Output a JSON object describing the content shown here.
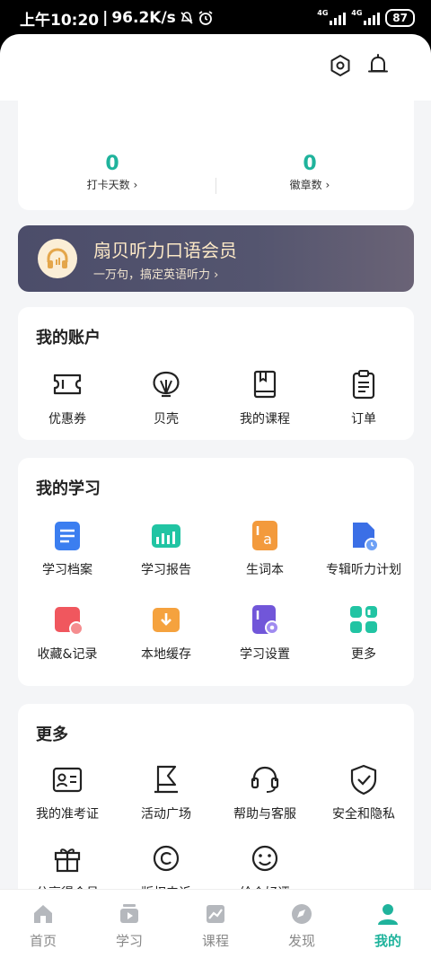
{
  "status_bar": {
    "time": "上午10:20",
    "speed": "96.2K/s",
    "network1": "4G",
    "network2": "4G",
    "battery": "87"
  },
  "stats": {
    "checkin_count": "0",
    "checkin_label": "打卡天数",
    "badge_count": "0",
    "badge_label": "徽章数"
  },
  "vip": {
    "title": "扇贝听力口语会员",
    "subtitle": "一万句，搞定英语听力"
  },
  "account": {
    "title": "我的账户",
    "items": [
      {
        "label": "优惠券"
      },
      {
        "label": "贝壳"
      },
      {
        "label": "我的课程"
      },
      {
        "label": "订单"
      }
    ]
  },
  "study": {
    "title": "我的学习",
    "items": [
      {
        "label": "学习档案"
      },
      {
        "label": "学习报告"
      },
      {
        "label": "生词本"
      },
      {
        "label": "专辑听力计划"
      },
      {
        "label": "收藏&记录"
      },
      {
        "label": "本地缓存"
      },
      {
        "label": "学习设置"
      },
      {
        "label": "更多"
      }
    ]
  },
  "more": {
    "title": "更多",
    "items": [
      {
        "label": "我的准考证"
      },
      {
        "label": "活动广场"
      },
      {
        "label": "帮助与客服"
      },
      {
        "label": "安全和隐私"
      },
      {
        "label": "分享得会员"
      },
      {
        "label": "版权申诉"
      },
      {
        "label": "给个好评"
      }
    ]
  },
  "tabbar": {
    "tabs": [
      {
        "label": "首页"
      },
      {
        "label": "学习"
      },
      {
        "label": "课程"
      },
      {
        "label": "发现"
      },
      {
        "label": "我的"
      }
    ],
    "active_color": "#1fb39c"
  }
}
